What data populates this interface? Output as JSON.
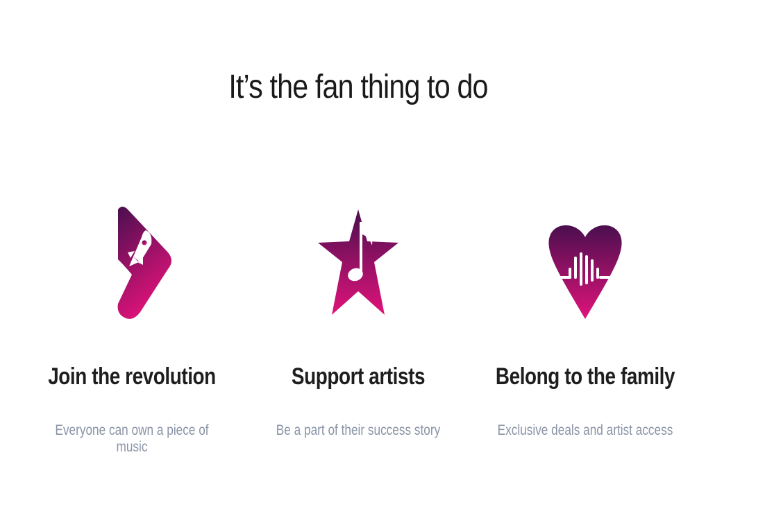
{
  "heading": "It’s the fan thing to do",
  "colors": {
    "gradient_dark": "#4a0f4f",
    "gradient_light": "#e0137a",
    "heading_text": "#1a1a1a",
    "title_text": "#1e1e1e",
    "desc_text": "#8a93a6",
    "background": "#ffffff"
  },
  "features": [
    {
      "icon": "rocket-play-icon",
      "title": "Join the revolution",
      "description": "Everyone can own a piece of music"
    },
    {
      "icon": "star-music-note-icon",
      "title": "Support artists",
      "description": "Be a part of their success story"
    },
    {
      "icon": "heart-soundwave-icon",
      "title": "Belong to the family",
      "description": "Exclusive deals and artist access"
    }
  ]
}
